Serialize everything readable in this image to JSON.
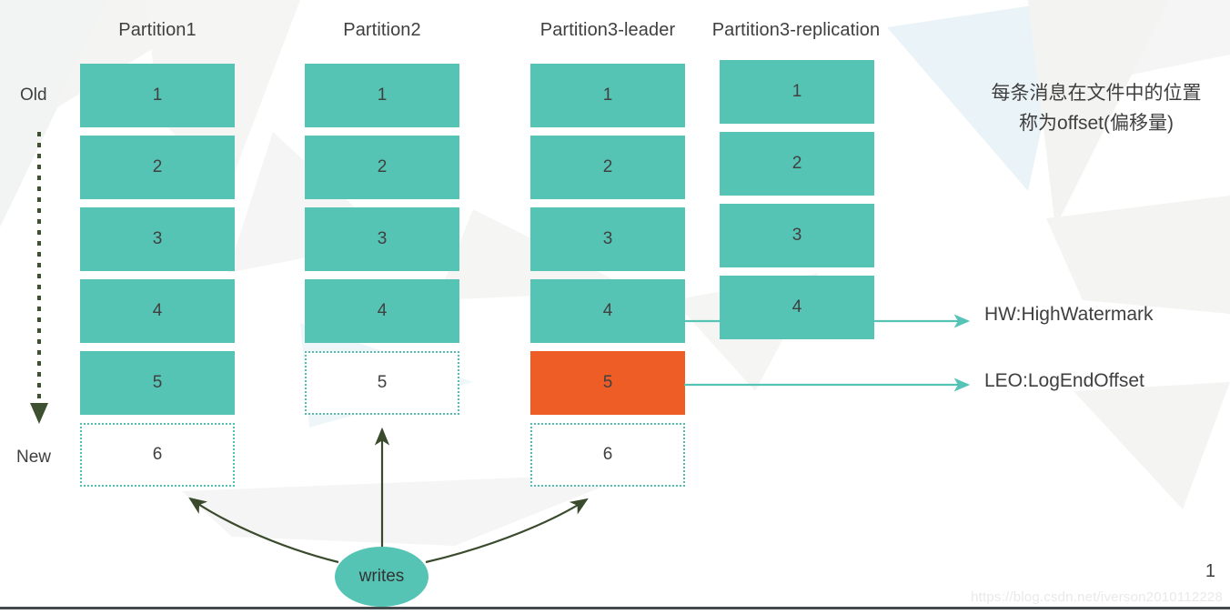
{
  "diagram": {
    "title_hidden": "Kafka partition offset / HW / LEO diagram",
    "colors": {
      "teal": "#56c4b5",
      "accent_orange": "#ef5d27",
      "arrow_green": "#3a4a2c",
      "arrow_teal": "#56c4b5",
      "text": "#3f3f3f"
    },
    "columns": [
      {
        "title": "Partition1",
        "boxes": [
          {
            "label": "1",
            "style": "filled"
          },
          {
            "label": "2",
            "style": "filled"
          },
          {
            "label": "3",
            "style": "filled"
          },
          {
            "label": "4",
            "style": "filled"
          },
          {
            "label": "5",
            "style": "filled"
          },
          {
            "label": "6",
            "style": "ghost"
          }
        ]
      },
      {
        "title": "Partition2",
        "boxes": [
          {
            "label": "1",
            "style": "filled"
          },
          {
            "label": "2",
            "style": "filled"
          },
          {
            "label": "3",
            "style": "filled"
          },
          {
            "label": "4",
            "style": "filled"
          },
          {
            "label": "5",
            "style": "ghost"
          }
        ]
      },
      {
        "title": "Partition3-leader",
        "boxes": [
          {
            "label": "1",
            "style": "filled"
          },
          {
            "label": "2",
            "style": "filled"
          },
          {
            "label": "3",
            "style": "filled"
          },
          {
            "label": "4",
            "style": "filled"
          },
          {
            "label": "5",
            "style": "accent"
          },
          {
            "label": "6",
            "style": "ghost"
          }
        ]
      },
      {
        "title": "Partition3-replication",
        "boxes": [
          {
            "label": "1",
            "style": "filled"
          },
          {
            "label": "2",
            "style": "filled"
          },
          {
            "label": "3",
            "style": "filled"
          },
          {
            "label": "4",
            "style": "filled"
          }
        ]
      }
    ],
    "axis": {
      "old_label": "Old",
      "new_label": "New"
    },
    "annotations": {
      "hw": "HW:HighWatermark",
      "leo": "LEO:LogEndOffset",
      "note_line1": "每条消息在文件中的位置",
      "note_line2": "称为offset(偏移量)"
    },
    "writes_node": {
      "label": "writes"
    },
    "footer": {
      "page_number": "1",
      "watermark": "https://blog.csdn.net/iverson2010112228"
    }
  }
}
